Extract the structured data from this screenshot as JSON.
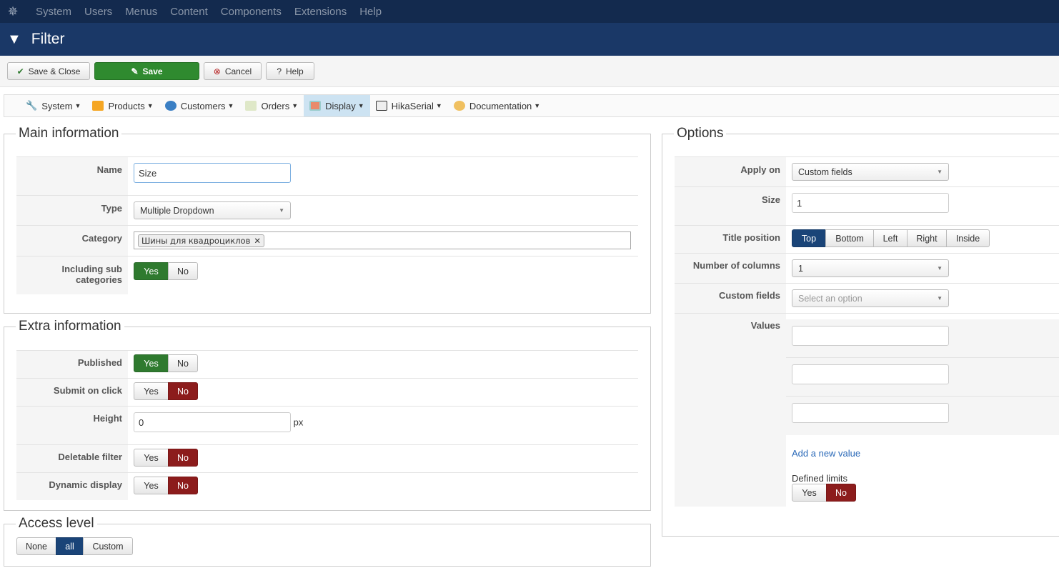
{
  "topmenu": [
    "System",
    "Users",
    "Menus",
    "Content",
    "Components",
    "Extensions",
    "Help"
  ],
  "title": "Filter",
  "toolbar": {
    "save_close": "Save & Close",
    "save": "Save",
    "cancel": "Cancel",
    "help": "Help"
  },
  "submenu": [
    "System",
    "Products",
    "Customers",
    "Orders",
    "Display",
    "HikaSerial",
    "Documentation"
  ],
  "main": {
    "legend": "Main information",
    "name_label": "Name",
    "name_value": "Size",
    "type_label": "Type",
    "type_value": "Multiple Dropdown",
    "category_label": "Category",
    "category_tag": "Шины для квадроциклов",
    "sub_label": "Including sub categories",
    "yes": "Yes",
    "no": "No"
  },
  "extra": {
    "legend": "Extra information",
    "published": "Published",
    "submit": "Submit on click",
    "height": "Height",
    "height_value": "0",
    "px": "px",
    "deletable": "Deletable filter",
    "dynamic": "Dynamic display",
    "yes": "Yes",
    "no": "No"
  },
  "access": {
    "legend": "Access level",
    "options": [
      "None",
      "all",
      "Custom"
    ]
  },
  "options": {
    "legend": "Options",
    "apply_label": "Apply on",
    "apply_value": "Custom fields",
    "size_label": "Size",
    "size_value": "1",
    "title_pos_label": "Title position",
    "title_pos": [
      "Top",
      "Bottom",
      "Left",
      "Right",
      "Inside"
    ],
    "columns_label": "Number of columns",
    "columns_value": "1",
    "custom_label": "Custom fields",
    "custom_placeholder": "Select an option",
    "values_label": "Values",
    "add_value": "Add a new value",
    "limits_label": "Defined limits",
    "yes": "Yes",
    "no": "No"
  }
}
